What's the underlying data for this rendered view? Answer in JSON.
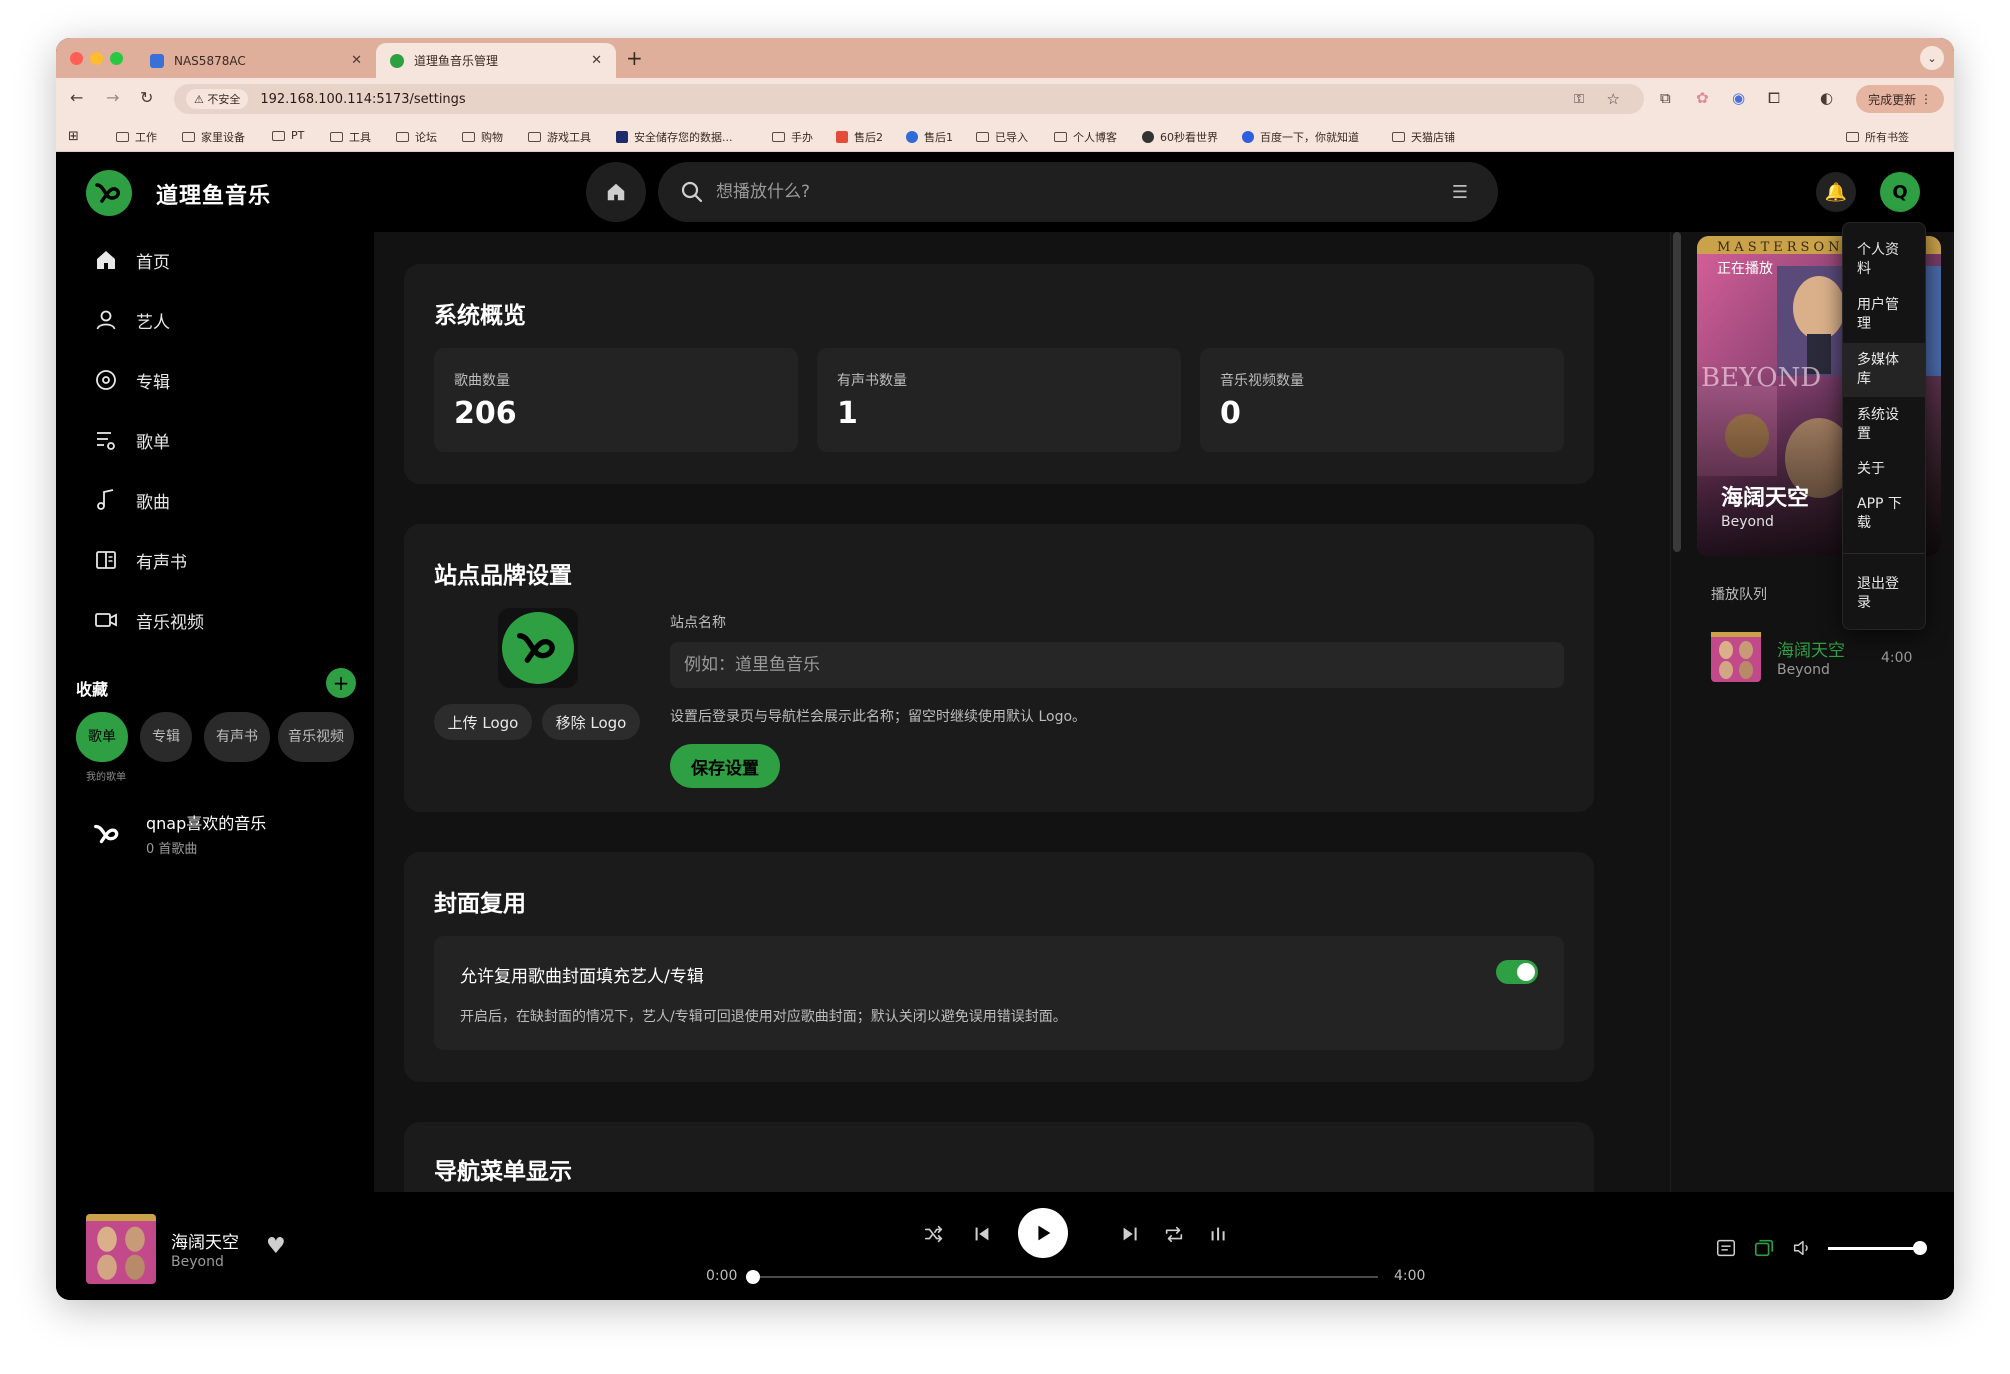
{
  "browser": {
    "tabs": [
      {
        "title": "NAS5878AC",
        "active": false
      },
      {
        "title": "道理鱼音乐管理",
        "active": true
      }
    ],
    "address": {
      "security": "不安全",
      "url": "192.168.100.114:5173/settings"
    },
    "update_label": "完成更新",
    "bookmarks": [
      "工作",
      "家里设备",
      "PT",
      "工具",
      "论坛",
      "购物",
      "游戏工具",
      "安全储存您的数据...",
      "手办",
      "售后2",
      "售后1",
      "已导入",
      "个人博客",
      "60秒看世界",
      "百度一下，你就知道",
      "天猫店铺"
    ],
    "all_bookmarks": "所有书签"
  },
  "app": {
    "brand": "道理鱼音乐",
    "search_placeholder": "想播放什么?",
    "avatar_letter": "Q",
    "accent": "#2ea043"
  },
  "sidebar": {
    "nav": [
      {
        "label": "首页",
        "icon": "home-icon"
      },
      {
        "label": "艺人",
        "icon": "person-icon"
      },
      {
        "label": "专辑",
        "icon": "album-icon"
      },
      {
        "label": "歌单",
        "icon": "playlist-icon"
      },
      {
        "label": "歌曲",
        "icon": "music-note-icon"
      },
      {
        "label": "有声书",
        "icon": "book-icon"
      },
      {
        "label": "音乐视频",
        "icon": "video-icon"
      }
    ],
    "favorites_title": "收藏",
    "chips": [
      {
        "label": "歌单",
        "active": true
      },
      {
        "label": "专辑",
        "active": false
      },
      {
        "label": "有声书",
        "active": false
      },
      {
        "label": "音乐视频",
        "active": false
      }
    ],
    "chip_caption": "我的歌单",
    "playlist": {
      "title": "qnap喜欢的音乐",
      "subtitle": "0 首歌曲"
    }
  },
  "settings": {
    "overview": {
      "title": "系统概览",
      "stats": [
        {
          "label": "歌曲数量",
          "value": "206"
        },
        {
          "label": "有声书数量",
          "value": "1"
        },
        {
          "label": "音乐视频数量",
          "value": "0"
        }
      ]
    },
    "branding": {
      "title": "站点品牌设置",
      "upload_label": "上传 Logo",
      "remove_label": "移除 Logo",
      "field_label": "站点名称",
      "field_placeholder": "例如：道里鱼音乐",
      "hint": "设置后登录页与导航栏会展示此名称；留空时继续使用默认 Logo。",
      "save_label": "保存设置"
    },
    "cover_reuse": {
      "title": "封面复用",
      "toggle_label": "允许复用歌曲封面填充艺人/专辑",
      "toggle_desc": "开启后，在缺封面的情况下，艺人/专辑可回退使用对应歌曲封面；默认关闭以避免误用错误封面。",
      "enabled": true
    },
    "nav_display": {
      "title": "导航菜单显示"
    }
  },
  "now_playing": {
    "cover_label": "正在播放",
    "title": "海阔天空",
    "artist": "Beyond",
    "cover_text_top": "MASTERSONIC",
    "cover_text_brand": "BEYOND"
  },
  "queue": {
    "title": "播放队列",
    "items": [
      {
        "title": "海阔天空",
        "artist": "Beyond",
        "duration": "4:00"
      }
    ]
  },
  "user_menu": {
    "items": [
      "个人资料",
      "用户管理",
      "多媒体库",
      "系统设置",
      "关于",
      "APP 下载",
      "退出登录"
    ]
  },
  "player": {
    "title": "海阔天空",
    "artist": "Beyond",
    "current_time": "0:00",
    "total_time": "4:00",
    "progress": 0,
    "volume": 0.9
  }
}
